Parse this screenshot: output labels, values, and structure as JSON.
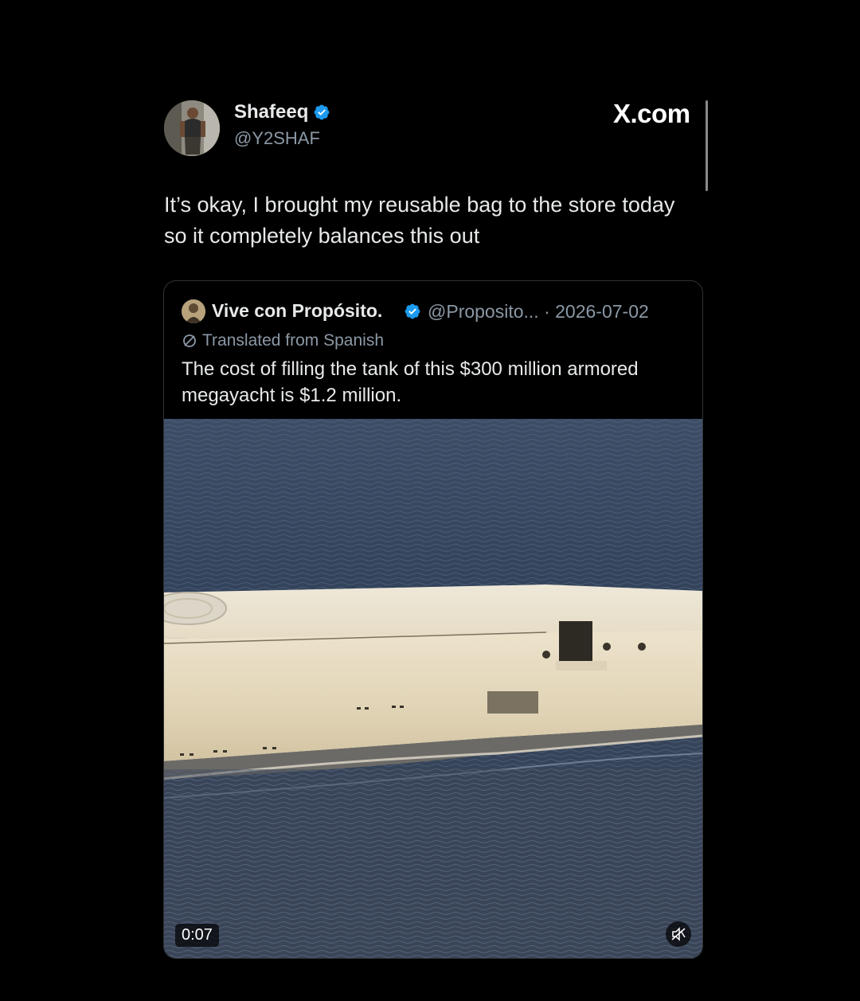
{
  "post": {
    "author": {
      "display_name": "Shafeeq",
      "handle": "@Y2SHAF",
      "verified": true
    },
    "brand": "X.com",
    "text": "It’s okay, I brought my reusable bag to the store today so it completely balances this out"
  },
  "quoted_post": {
    "author": {
      "display_name": "Vive con Propósito.",
      "verified": true
    },
    "meta": "@Proposito... · 2026-07-02",
    "translated_label": "Translated from Spanish",
    "text": "The cost of filling the tank of this $300 million armored megayacht is $1.2 million.",
    "video": {
      "duration": "0:07",
      "muted": true
    }
  },
  "colors": {
    "background": "#000000",
    "text_primary": "#e7e9ea",
    "text_secondary": "#8b98a5",
    "verified_blue": "#1d9bf0",
    "card_border": "#2f3336"
  },
  "icons": {
    "verified": "verified-badge-icon",
    "translate": "translate-icon",
    "mute": "mute-icon"
  }
}
